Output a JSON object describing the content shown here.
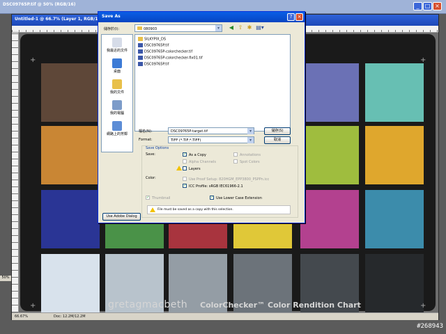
{
  "app": {
    "back_window_title": "DSC09765P.tif @ 50% (RGB/16)",
    "doc_window_title": "Untitled-1 @ 66.7% (Layer 1, RGB/16)",
    "status_zoom": "66.67%",
    "status_doc": "Doc: 12.2M/12.2M",
    "side_zoom": "50%"
  },
  "chart": {
    "brand": "gretagmacbeth",
    "name": "ColorChecker™ Color Rendition Chart",
    "patch_colors": [
      "#5e4738",
      "#b8877a",
      "#5a71a1",
      "#586a45",
      "#6b71b5",
      "#67bfb3",
      "#c98634",
      "#4a5ba8",
      "#b9505e",
      "#4a2f5f",
      "#9fbd3e",
      "#dfa72d",
      "#2a3595",
      "#4a9248",
      "#a8343e",
      "#e0c838",
      "#b3418f",
      "#3c8cab",
      "#d8e2ec",
      "#b8c3cc",
      "#949da5",
      "#6c737a",
      "#44494e",
      "#26292c"
    ]
  },
  "dialog": {
    "title": "Save As",
    "save_in_label": "儲存於(I):",
    "save_in_value": "080903",
    "places": [
      "我最近的文件",
      "桌面",
      "我的文件",
      "我的電腦",
      "網路上的芳鄰"
    ],
    "files": [
      {
        "name": "SILKYPIX_DS",
        "type": "folder"
      },
      {
        "name": "DSC09765P.tif",
        "type": "tif"
      },
      {
        "name": "DSC09765P-colorchecker.tif",
        "type": "tif"
      },
      {
        "name": "DSC09765P-colorchecker-fix01.tif",
        "type": "tif"
      },
      {
        "name": "DSC09765P.tif",
        "type": "tif"
      }
    ],
    "filename_label": "檔名(N):",
    "filename_value": "DSC09765P-target.tif",
    "format_label": "Format:",
    "format_value": "TIFF (*.TIF;*.TIFF)",
    "save_button": "儲存(S)",
    "cancel_button": "取消",
    "save_options_title": "Save Options",
    "save_label": "Save:",
    "as_copy": "As a Copy",
    "annotations": "Annotations",
    "alpha_channels": "Alpha Channels",
    "spot_colors": "Spot Colors",
    "layers": "Layers",
    "color_label": "Color:",
    "use_proof_setup": "Use Proof Setup: 820HGM_EPP3800_PSPPn.icc",
    "icc_profile": "ICC Profile:  sRGB IEC61966-2.1",
    "thumbnail": "Thumbnail",
    "lower_case_ext": "Use Lower Case Extension",
    "warning": "File must be saved as a copy with this selection.",
    "adobe_dialog_button": "Use Adobe Dialog"
  },
  "watermark": "#268943"
}
